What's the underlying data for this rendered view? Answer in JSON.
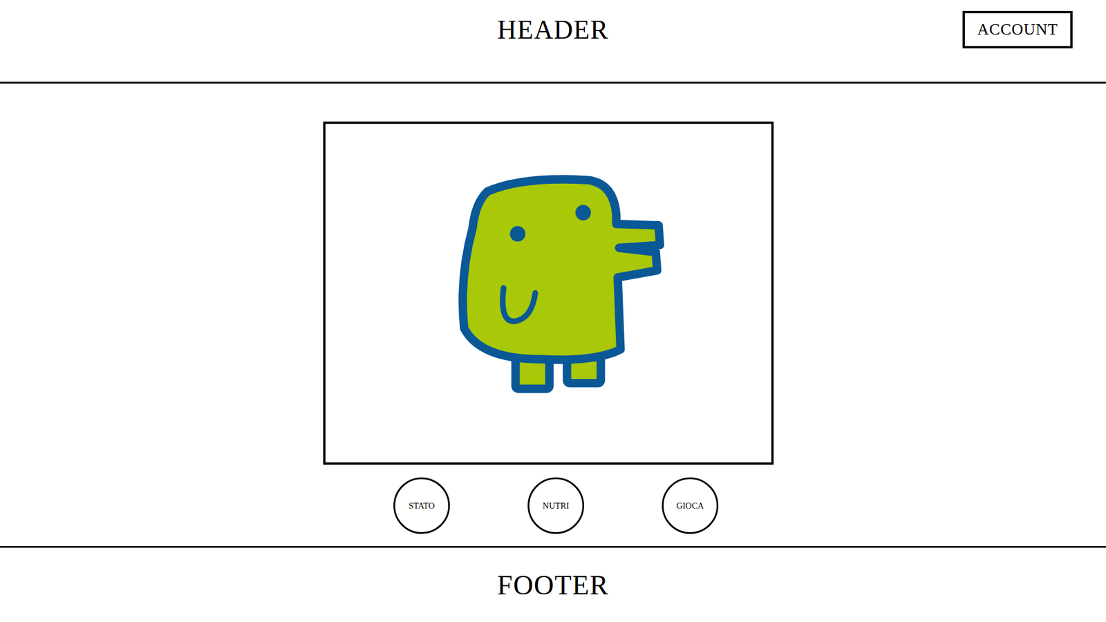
{
  "header": {
    "title": "HEADER",
    "account_button": "ACCOUNT"
  },
  "actions": [
    {
      "label": "STATO"
    },
    {
      "label": "NUTRI"
    },
    {
      "label": "GIOCA"
    }
  ],
  "footer": {
    "title": "FOOTER"
  }
}
